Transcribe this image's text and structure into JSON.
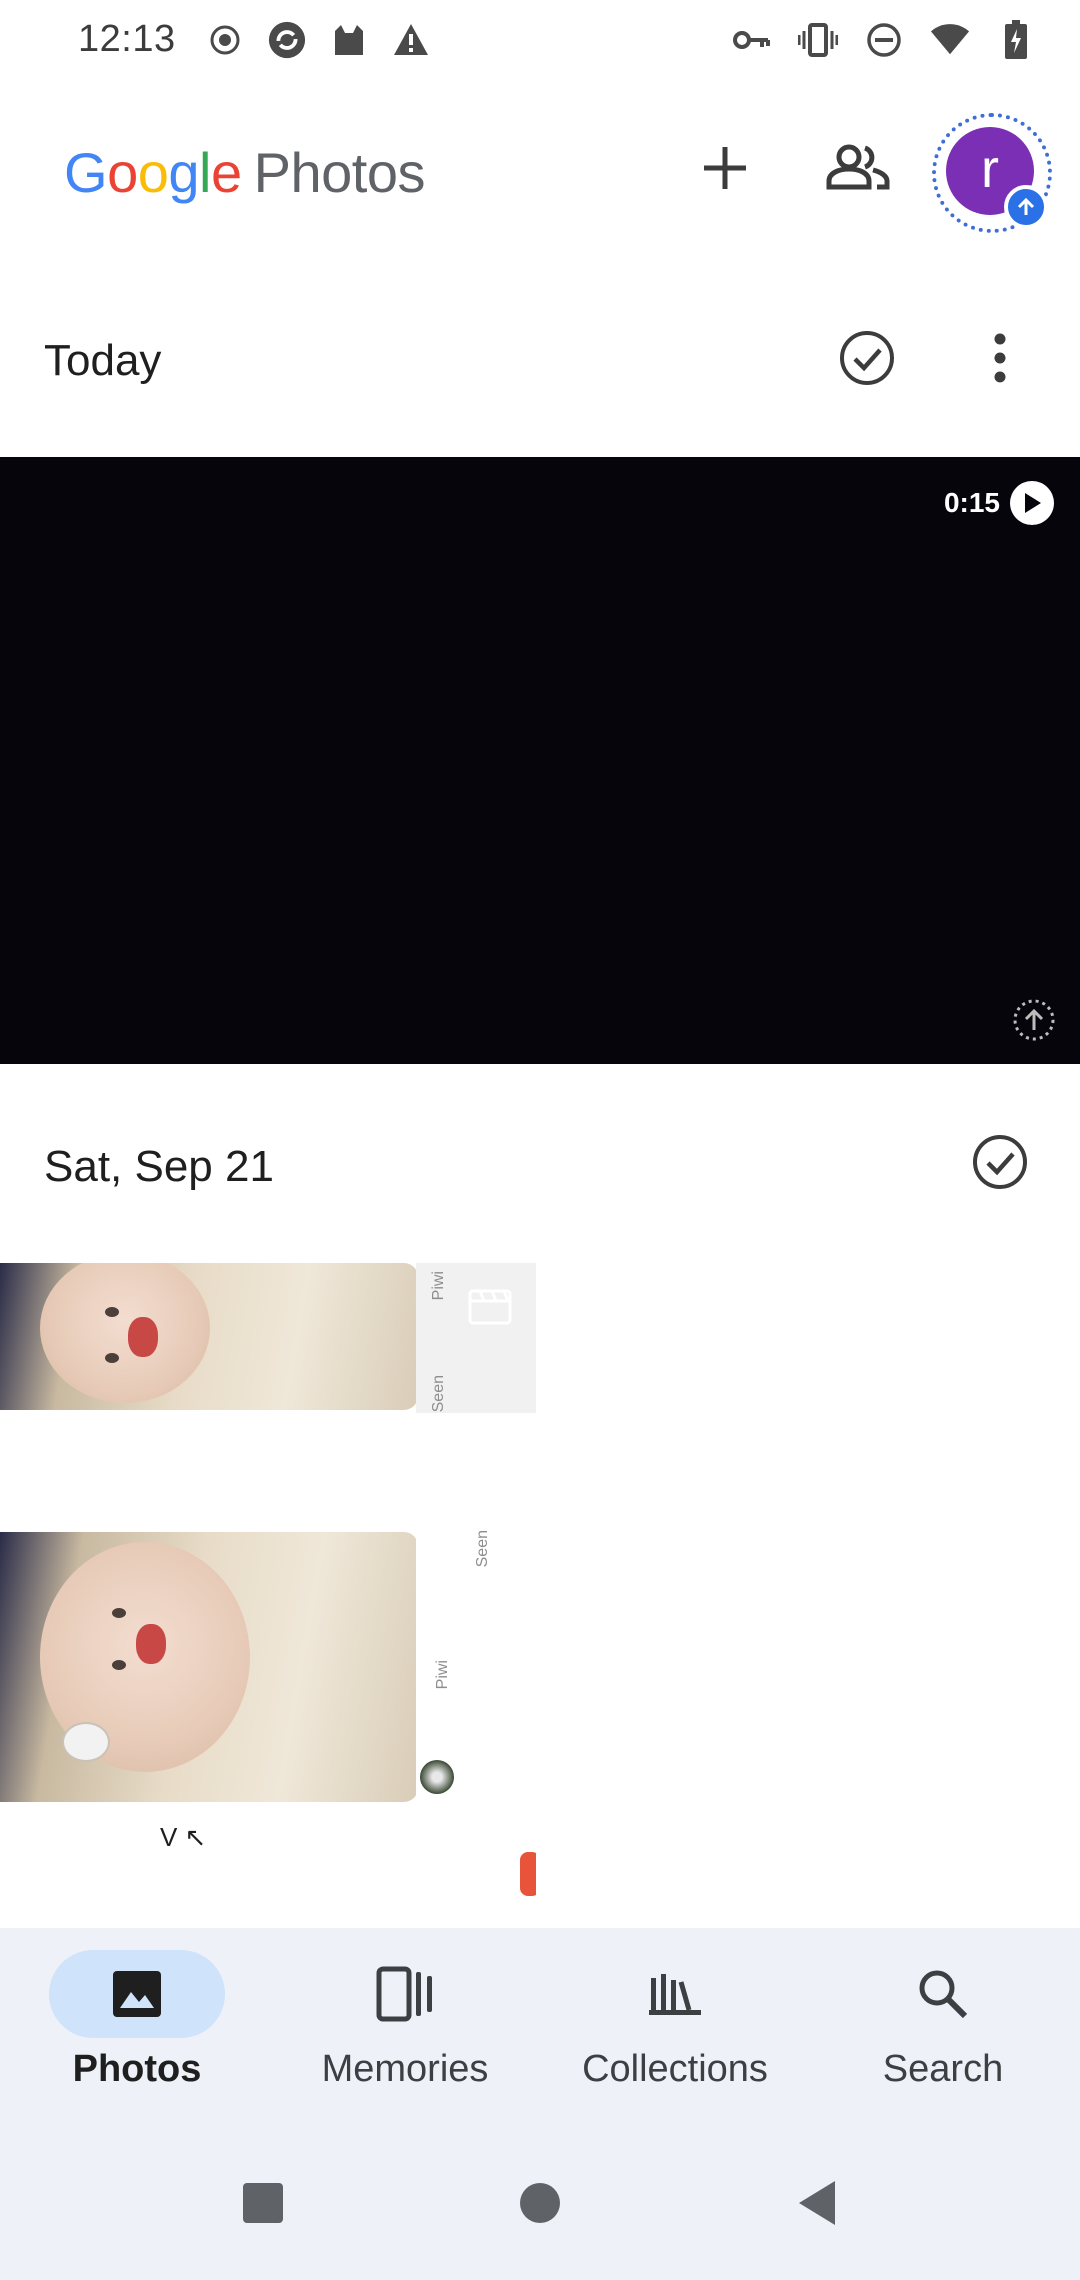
{
  "status_bar": {
    "time": "12:13"
  },
  "app_bar": {
    "logo_letters": [
      "G",
      "o",
      "o",
      "g",
      "l",
      "e"
    ],
    "logo_product": "Photos",
    "avatar_initial": "r"
  },
  "sections": [
    {
      "title": "Today"
    },
    {
      "title": "Sat, Sep 21"
    }
  ],
  "video": {
    "duration": "0:15"
  },
  "thumbnails": {
    "thumb1_side_texts": [
      "Piwi",
      "Seen"
    ],
    "thumb2_side_texts": [
      "Seen",
      "Piwi"
    ],
    "thumb2_bottom_text": "V  ↖"
  },
  "bottom_nav": {
    "items": [
      {
        "label": "Photos",
        "icon": "photo-icon",
        "active": true
      },
      {
        "label": "Memories",
        "icon": "memories-icon",
        "active": false
      },
      {
        "label": "Collections",
        "icon": "collections-icon",
        "active": false
      },
      {
        "label": "Search",
        "icon": "search-icon",
        "active": false
      }
    ]
  },
  "colors": {
    "google_blue": "#4285F4",
    "google_red": "#EA4335",
    "google_yellow": "#FBBC05",
    "google_green": "#34A853",
    "avatar": "#7b2fb5",
    "active_pill": "#cfe3fb",
    "nav_background": "#eef2f8"
  }
}
